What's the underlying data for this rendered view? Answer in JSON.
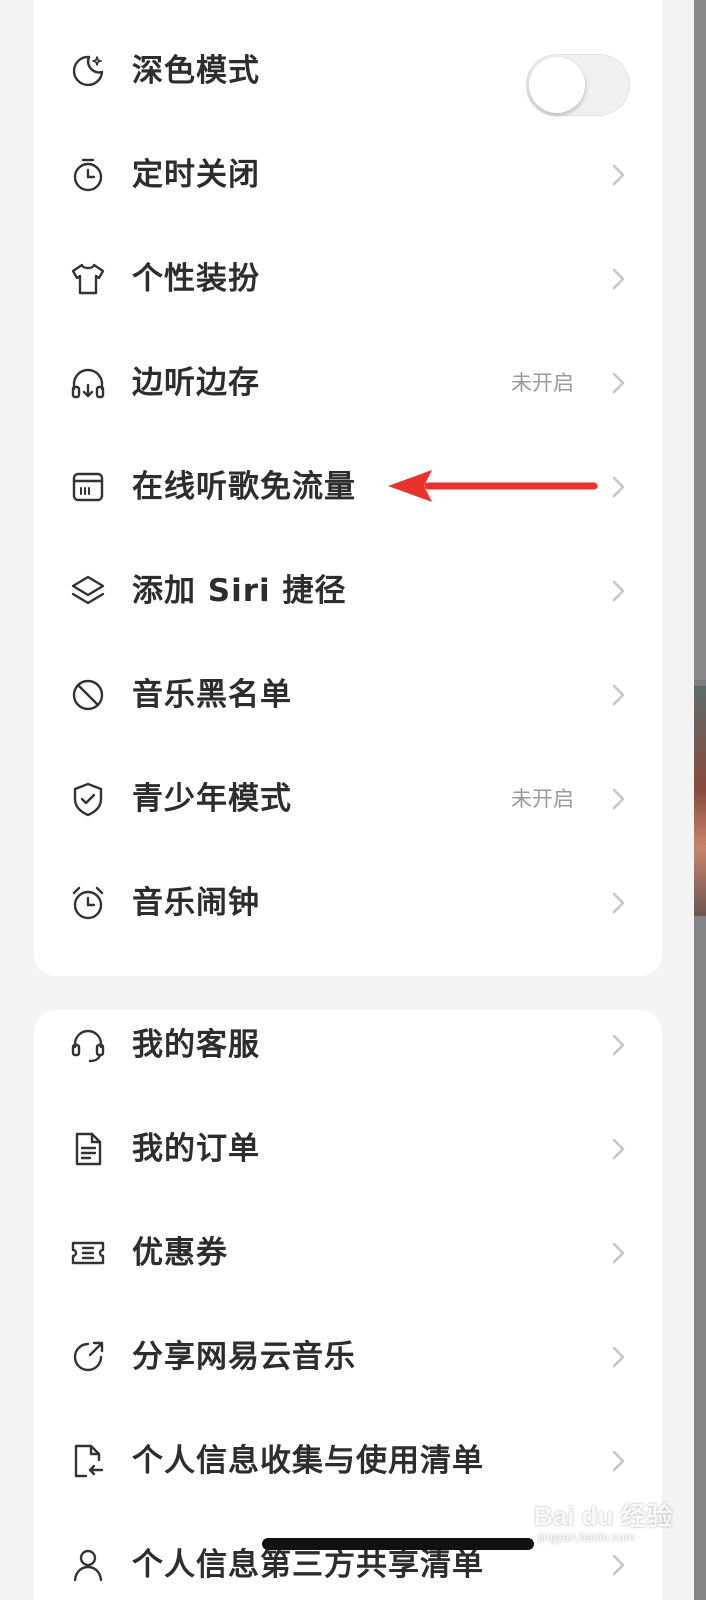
{
  "settings_card": {
    "items": [
      {
        "label": "深色模式",
        "icon": "moon-icon",
        "control": "toggle",
        "toggle_on": false
      },
      {
        "label": "定时关闭",
        "icon": "timer-icon",
        "control": "chevron"
      },
      {
        "label": "个性装扮",
        "icon": "tshirt-icon",
        "control": "chevron"
      },
      {
        "label": "边听边存",
        "icon": "headphones-icon",
        "status": "未开启",
        "control": "chevron"
      },
      {
        "label": "在线听歌免流量",
        "icon": "sim-card-icon",
        "control": "chevron"
      },
      {
        "label": "添加 Siri 捷径",
        "icon": "layers-icon",
        "control": "chevron"
      },
      {
        "label": "音乐黑名单",
        "icon": "block-icon",
        "control": "chevron"
      },
      {
        "label": "青少年模式",
        "icon": "shield-check-icon",
        "status": "未开启",
        "control": "chevron"
      },
      {
        "label": "音乐闹钟",
        "icon": "alarm-clock-icon",
        "control": "chevron"
      }
    ]
  },
  "support_card": {
    "items": [
      {
        "label": "我的客服",
        "icon": "headset-icon",
        "control": "chevron"
      },
      {
        "label": "我的订单",
        "icon": "document-icon",
        "control": "chevron"
      },
      {
        "label": "优惠券",
        "icon": "ticket-icon",
        "control": "chevron"
      },
      {
        "label": "分享网易云音乐",
        "icon": "share-icon",
        "control": "chevron"
      },
      {
        "label": "个人信息收集与使用清单",
        "icon": "file-return-icon",
        "control": "chevron"
      },
      {
        "label": "个人信息第三方共享清单",
        "icon": "user-share-icon",
        "control": "chevron"
      }
    ]
  },
  "annotation": {
    "arrow_color": "#e8322b",
    "points_to": "在线听歌免流量"
  },
  "colors": {
    "background": "#f3f3f4",
    "card": "#ffffff",
    "text": "#2d2d2d",
    "status": "#9a9a9a",
    "chevron": "#c4c4c4"
  },
  "watermark": {
    "main": "Bai du 经验",
    "sub": "jingyan.baidu.com"
  }
}
